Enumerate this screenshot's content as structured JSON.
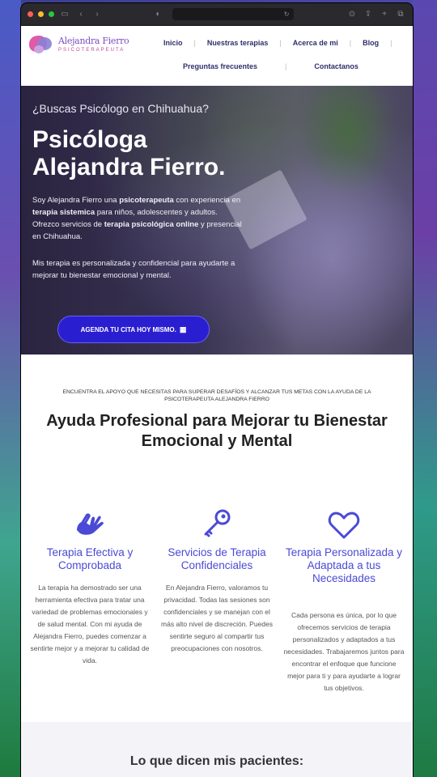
{
  "browser": {
    "toolbar_icons": [
      "sidebar-icon",
      "back-icon",
      "forward-icon",
      "shield-icon",
      "reload-icon",
      "download-icon",
      "share-icon",
      "new-tab-icon",
      "tabs-icon"
    ]
  },
  "site": {
    "logo": {
      "name": "Alejandra Fierro",
      "subtitle": "PSICOTERAPEUTA"
    },
    "nav": {
      "inicio": "Inicio",
      "terapias": "Nuestras terapias",
      "acerca": "Acerca de mi",
      "blog": "Blog",
      "faq": "Preguntas frecuentes",
      "contacto": "Contactanos"
    }
  },
  "hero": {
    "kicker": "¿Buscas Psicólogo en Chihuahua?",
    "title_line1": "Psicóloga",
    "title_line2": "Alejandra Fierro.",
    "p1_a": "Soy Alejandra Fierro una ",
    "p1_b": "psicoterapeuta",
    "p1_c": " con experiencia en ",
    "p1_d": "terapia sistemica",
    "p1_e": " para niños, adolescentes y adultos. Ofrezco servicios de ",
    "p1_f": "terapia psicológica online",
    "p1_g": " y presencial en Chihuahua.",
    "p2": "Mis terapia es personalizada y confidencial para ayudarte a mejorar tu bienestar emocional y mental.",
    "cta": "AGENDA TU CITA HOY MISMO."
  },
  "intro": {
    "kicker": "ENCUENTRA EL APOYO QUE NECESITAS PARA SUPERAR DESAFÍOS Y ALCANZAR TUS METAS CON LA AYUDA DE LA PSICOTERAPEUTA ALEJANDRA FIERRO",
    "title": "Ayuda Profesional para Mejorar tu Bienestar Emocional y Mental"
  },
  "features": [
    {
      "icon": "helping-hands-icon",
      "title": "Terapia Efectiva y Comprobada",
      "text": "La terapia ha demostrado ser una herramienta efectiva para tratar una variedad de problemas emocionales y de salud mental. Con mi ayuda de Alejandra Fierro, puedes comenzar a sentirte mejor y a mejorar tu calidad de vida."
    },
    {
      "icon": "key-icon",
      "title": "Servicios de Terapia Confidenciales",
      "text": "En Alejandra Fierro, valoramos tu privacidad. Todas las sesiones son confidenciales y se manejan con el más alto nivel de discreción. Puedes sentirte seguro al compartir tus preocupaciones con nosotros."
    },
    {
      "icon": "heart-icon",
      "title": "Terapia Personalizada y Adaptada a tus Necesidades",
      "text": "Cada persona es única, por lo que ofrecemos servicios de terapia personalizados y adaptados a tus necesidades. Trabajaremos juntos para encontrar el enfoque que funcione mejor para ti y para ayudarte a lograr tus objetivos."
    }
  ],
  "testimonials": {
    "title": "Lo que dicen mis pacientes:"
  }
}
